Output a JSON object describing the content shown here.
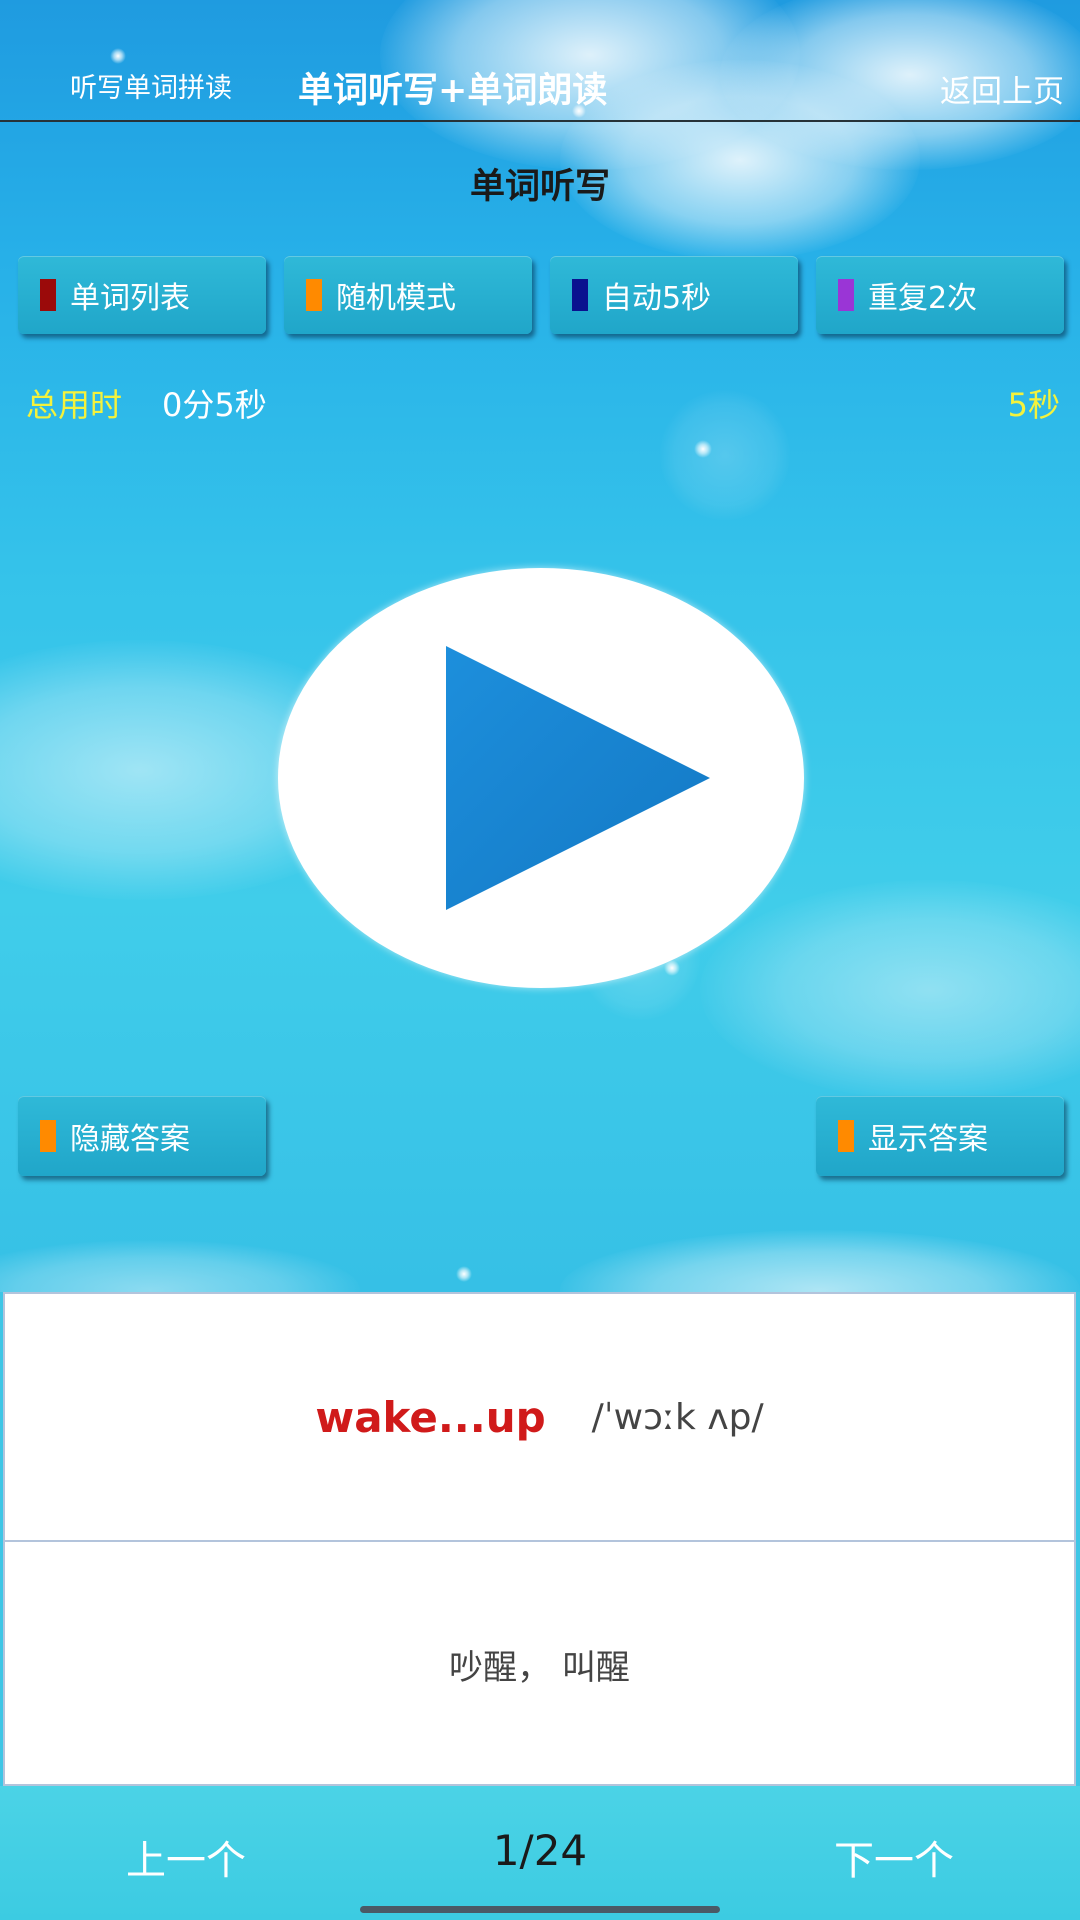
{
  "header": {
    "left_label": "听写单词拼读",
    "title": "单词听写+单词朗读",
    "back_label": "返回上页"
  },
  "section_title": "单词听写",
  "options": [
    {
      "label": "单词列表",
      "color": "#9b0a0a"
    },
    {
      "label": "随机模式",
      "color": "#ff8a00"
    },
    {
      "label": "自动5秒",
      "color": "#0a128f"
    },
    {
      "label": "重复2次",
      "color": "#9a35d6"
    }
  ],
  "timer": {
    "label": "总用时",
    "value": "0分5秒",
    "interval": "5秒"
  },
  "play": {
    "icon": "play-icon",
    "color": "#1a86d6"
  },
  "answer": {
    "hide_label": "隐藏答案",
    "show_label": "显示答案",
    "mark_color": "#ff8a00"
  },
  "card": {
    "word": "wake...up",
    "phonetic": "/ˈwɔːk ʌp/",
    "meaning": "吵醒， 叫醒"
  },
  "nav": {
    "prev_label": "上一个",
    "page": "1/24",
    "next_label": "下一个"
  },
  "colors": {
    "accent_yellow": "#f4f23c",
    "word_red": "#d01a1a"
  }
}
